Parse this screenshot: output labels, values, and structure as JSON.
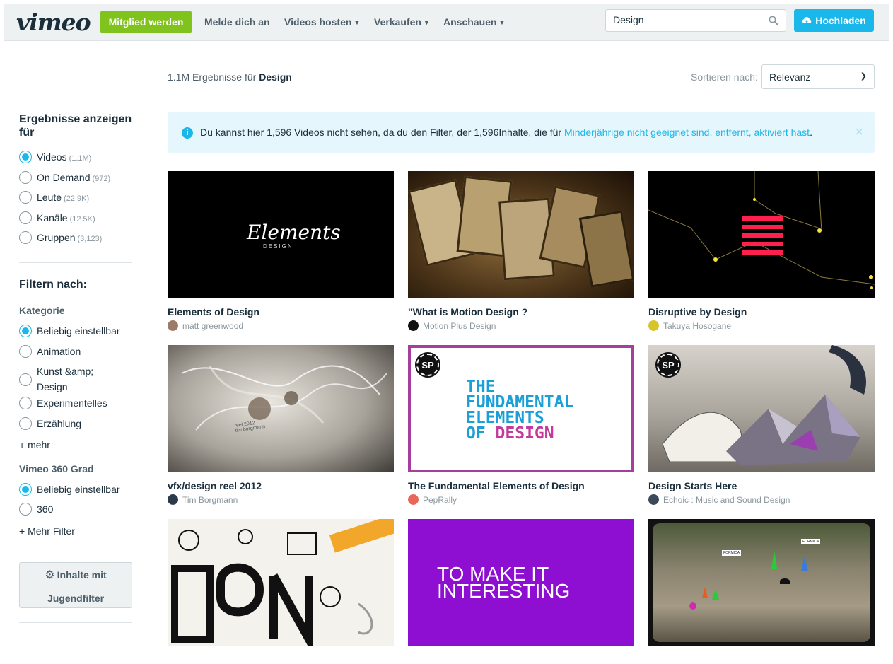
{
  "header": {
    "logo": "vimeo",
    "join_label": "Mitglied werden",
    "nav": [
      {
        "label": "Melde dich an",
        "has_chevron": false
      },
      {
        "label": "Videos hosten",
        "has_chevron": true
      },
      {
        "label": "Verkaufen",
        "has_chevron": true
      },
      {
        "label": "Anschauen",
        "has_chevron": true
      }
    ],
    "search_value": "Design",
    "upload_label": "Hochladen"
  },
  "results": {
    "count": "1.1M",
    "label_prefix": "Ergebnisse für",
    "query": "Design",
    "sort_label": "Sortieren nach:",
    "sort_value": "Relevanz"
  },
  "notice": {
    "text": "Du kannst hier 1,596 Videos nicht sehen, da du den Filter, der 1,596Inhalte, die für ",
    "link": "Minderjährige nicht geeignet sind, entfernt, aktiviert hast",
    "end": ".",
    "close": "×",
    "icon": "info-icon"
  },
  "sidebar": {
    "show_title": "Ergebnisse anzeigen für",
    "types": [
      {
        "label": "Videos",
        "count": "(1.1M)",
        "selected": true
      },
      {
        "label": "On Demand",
        "count": "(972)",
        "selected": false
      },
      {
        "label": "Leute",
        "count": "(22.9K)",
        "selected": false
      },
      {
        "label": "Kanäle",
        "count": "(12.5K)",
        "selected": false
      },
      {
        "label": "Gruppen",
        "count": "(3,123)",
        "selected": false
      }
    ],
    "filter_title": "Filtern nach:",
    "category_title": "Kategorie",
    "categories": [
      {
        "label": "Beliebig einstellbar",
        "selected": true
      },
      {
        "label": "Animation",
        "selected": false
      },
      {
        "label": "Kunst &amp; Design",
        "selected": false
      },
      {
        "label": "Experimentelles",
        "selected": false
      },
      {
        "label": "Erzählung",
        "selected": false
      }
    ],
    "more_label": "+ mehr",
    "vr_title": "Vimeo 360 Grad",
    "vr_options": [
      {
        "label": "Beliebig einstellbar",
        "selected": true
      },
      {
        "label": "360",
        "selected": false
      }
    ],
    "more_filters_label": "+ Mehr Filter",
    "youth_filter_line1": "Inhalte mit",
    "youth_filter_line2": "Jugendfilter"
  },
  "videos": [
    {
      "title": "Elements of Design",
      "author": "matt greenwood"
    },
    {
      "title": "\"What is Motion Design ?",
      "author": "Motion Plus Design"
    },
    {
      "title": "Disruptive by Design",
      "author": "Takuya Hosogane"
    },
    {
      "title": "vfx/design reel 2012",
      "author": "Tim Borgmann"
    },
    {
      "title": "The Fundamental Elements of Design",
      "author": "PepRally"
    },
    {
      "title": "Design Starts Here",
      "author": "Echoic : Music and Sound Design"
    },
    {
      "title": "",
      "author": ""
    },
    {
      "title": "",
      "author": ""
    },
    {
      "title": "",
      "author": ""
    }
  ],
  "thumb_text": {
    "elements_logo": "Elements",
    "elements_sub": "DESIGN",
    "reel_text_1": "reel 2012",
    "reel_text_2": "tim borgmann",
    "fundamental_1": "THE",
    "fundamental_2": "FUNDAMENTAL",
    "fundamental_3": "ELEMENTS",
    "fundamental_4a": "OF ",
    "fundamental_4b": "DESIGN",
    "sp_badge": "SP",
    "interesting_1": "TO MAKE IT",
    "interesting_2": "INTERESTING",
    "formica_1": "FORMICA",
    "formica_2": "FORMICA"
  },
  "colors": {
    "brand_blue": "#1ab7ea",
    "join_green": "#7fc31c",
    "purple": "#8e0fd1"
  }
}
